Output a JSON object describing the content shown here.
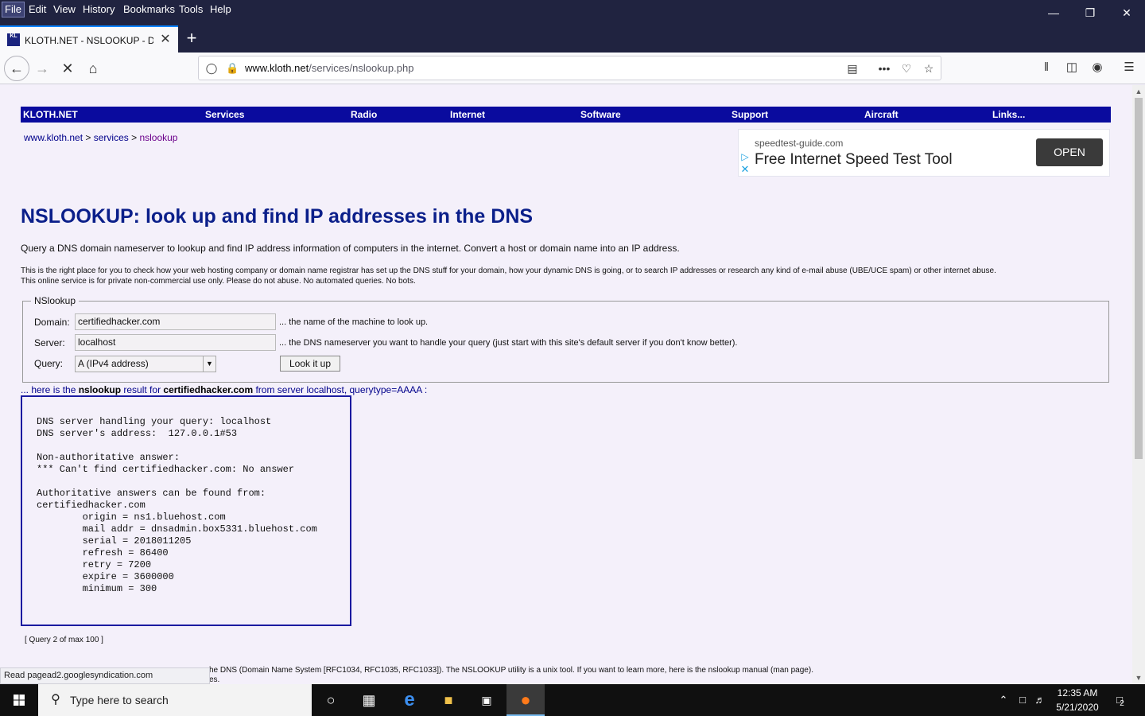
{
  "window": {
    "menu": [
      "File",
      "Edit",
      "View",
      "History",
      "Bookmarks",
      "Tools",
      "Help"
    ],
    "minimize_glyph": "—",
    "restore_glyph": "❐",
    "close_glyph": "✕"
  },
  "tab": {
    "title": "KLOTH.NET - NSLOOKUP - DNS",
    "favicon_text": "KL\nOTH",
    "close_glyph": "✕",
    "new_tab_glyph": "+"
  },
  "navbar": {
    "url_host": "www.kloth.net",
    "url_path": "/services/nslookup.php"
  },
  "site": {
    "nav": [
      "KLOTH.NET",
      "Services",
      "Radio",
      "Internet",
      "Software",
      "Support",
      "Aircraft",
      "Links..."
    ],
    "breadcrumb": {
      "home": "www.kloth.net",
      "sep": " > ",
      "services": "services",
      "current": "nslookup"
    },
    "ad": {
      "domain": "speedtest-guide.com",
      "headline": "Free Internet Speed Test Tool",
      "button": "OPEN"
    },
    "title": "NSLOOKUP: look up and find IP addresses in the DNS",
    "intro": "Query a DNS domain nameserver to lookup and find IP address information of computers in the internet. Convert a host or domain name into an IP address.",
    "blurb1": "This is the right place for you to check how your web hosting company or domain name registrar has set up the DNS stuff for your domain, how your dynamic DNS is going, or to search IP addresses or research any kind of e-mail abuse (UBE/UCE spam) or other internet abuse.",
    "blurb2": "This online service is for private non-commercial use only. Please do not abuse. No automated queries. No bots."
  },
  "form": {
    "legend": "NSlookup",
    "domain_label": "Domain:",
    "domain_value": "certifiedhacker.com",
    "domain_hint": "... the name of the machine to look up.",
    "server_label": "Server:",
    "server_value": "localhost",
    "server_hint": "... the DNS nameserver you want to handle your query (just start with this site's default server if you don't know better).",
    "query_label": "Query:",
    "query_value": "A (IPv4 address)",
    "submit_label": "Look it up"
  },
  "result": {
    "caption_prefix": "... here is the ",
    "caption_tool": "nslookup",
    "caption_mid": " result for ",
    "caption_domain": "certifiedhacker.com",
    "caption_suffix": " from server localhost, querytype=AAAA :",
    "output": "DNS server handling your query: localhost\nDNS server's address:  127.0.0.1#53\n\nNon-authoritative answer:\n*** Can't find certifiedhacker.com: No answer\n\nAuthoritative answers can be found from:\ncertifiedhacker.com\n\torigin = ns1.bluehost.com\n\tmail addr = dnsadmin.box5331.bluehost.com\n\tserial = 2018011205\n\trefresh = 86400\n\tretry = 7200\n\texpire = 3600000\n\tminimum = 300",
    "query_count": "[ Query 2 of max 100 ]"
  },
  "footer": {
    "line1": "he DNS (Domain Name System [RFC1034, RFC1035, RFC1033]). The NSLOOKUP utility is a unix tool. If you want to learn more, here is the nslookup manual (man page).",
    "line2": "es."
  },
  "statusbar": {
    "text": "Read pagead2.googlesyndication.com"
  },
  "taskbar": {
    "search_placeholder": "Type here to search",
    "time": "12:35 AM",
    "date": "5/21/2020",
    "notification_count": "2"
  }
}
